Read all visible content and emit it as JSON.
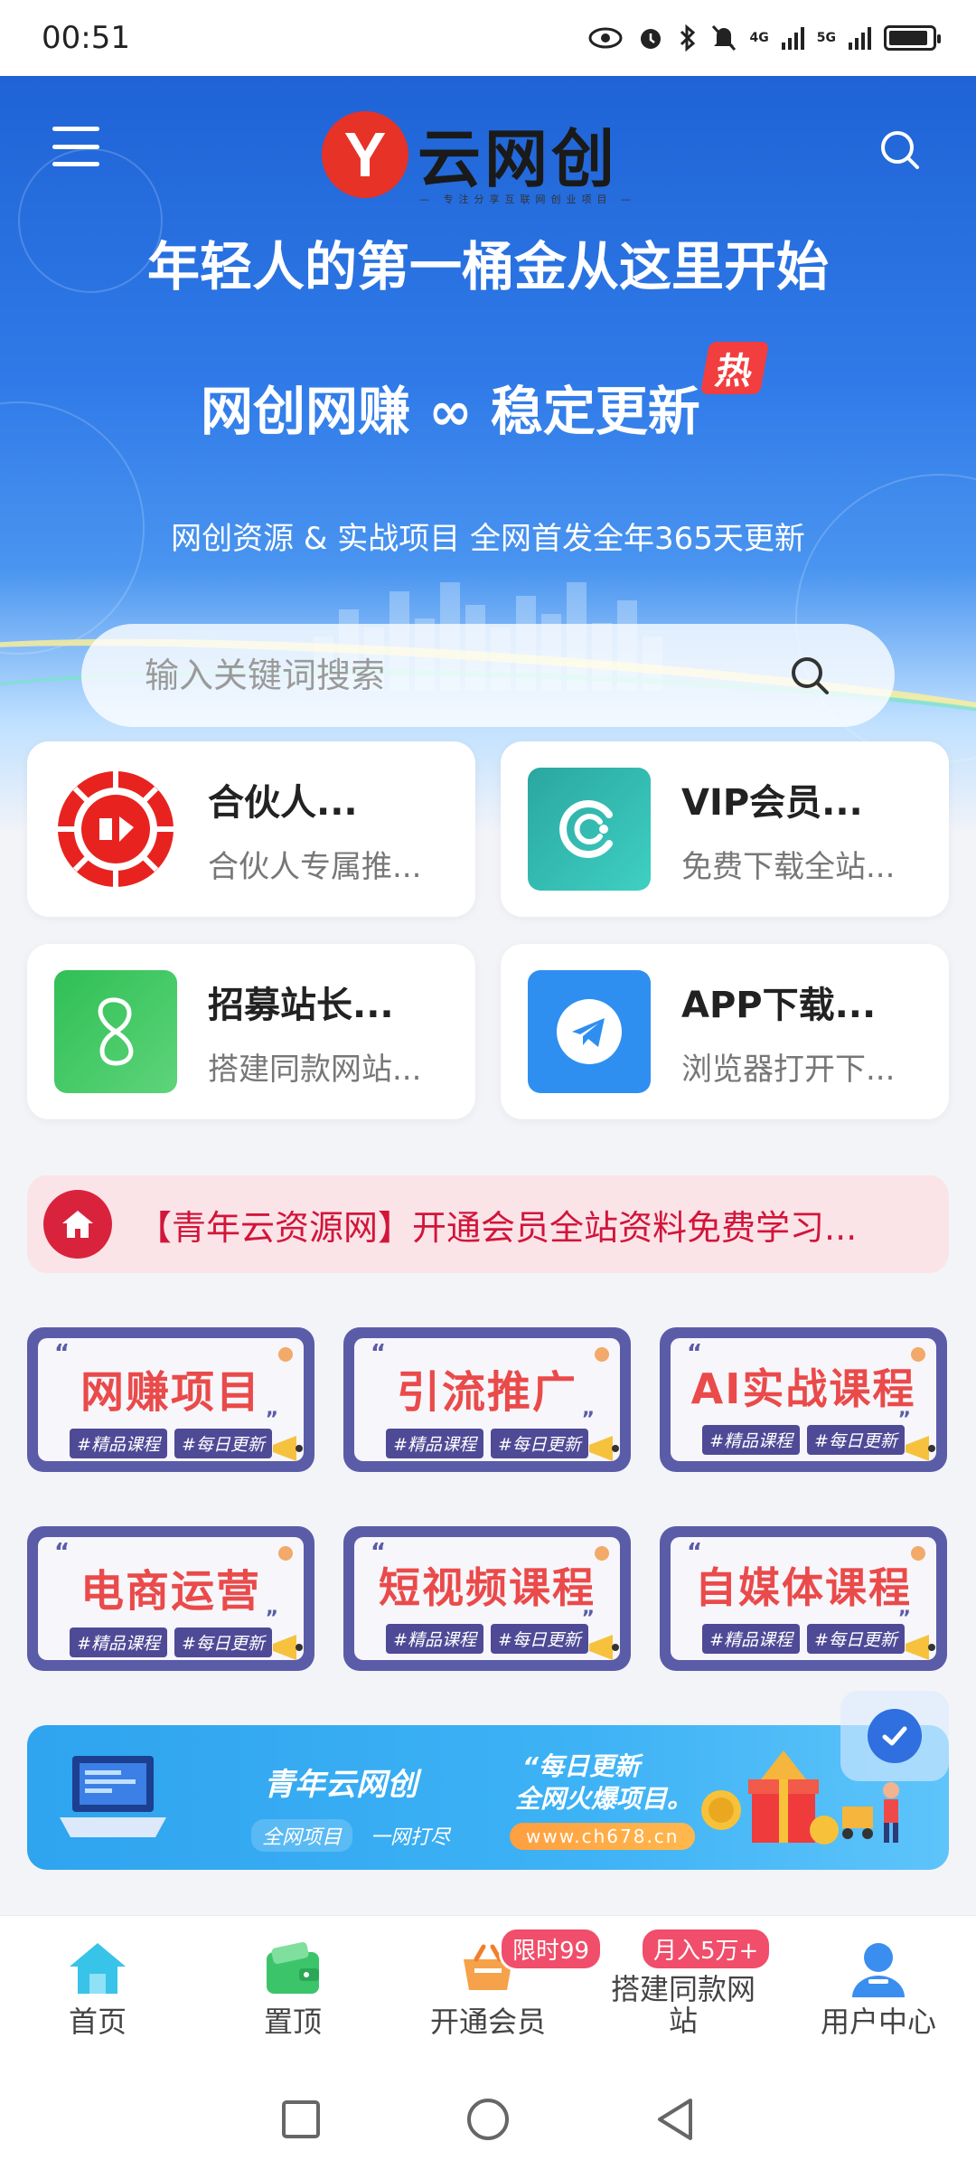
{
  "status_bar": {
    "time": "00:51",
    "network_1": "4G",
    "network_2": "5G",
    "icons": [
      "eye-icon",
      "alarm-icon",
      "bluetooth-icon",
      "mute-icon",
      "signal-icon",
      "signal-icon",
      "battery-icon"
    ]
  },
  "header": {
    "logo_letter": "Y",
    "logo_name": "云网创",
    "logo_tagline": "— 专注分享互联网创业项目 —"
  },
  "hero": {
    "headline_1": "年轻人的第一桶金从这里开始",
    "headline_2": "网创网赚 ∞ 稳定更新",
    "hot_badge": "热",
    "subtitle": "网创资源 & 实战项目 全网首发全年365天更新"
  },
  "search": {
    "placeholder": "输入关键词搜索"
  },
  "quick_cards": [
    {
      "title": "合伙人...",
      "desc": "合伙人专属推..."
    },
    {
      "title": "VIP会员...",
      "desc": "免费下载全站..."
    },
    {
      "title": "招募站长...",
      "desc": "搭建同款网站..."
    },
    {
      "title": "APP下载...",
      "desc": "浏览器打开下..."
    }
  ],
  "notice": {
    "text": "【青年云资源网】开通会员全站资料免费学习..."
  },
  "categories": {
    "tag_1": "#精品课程",
    "tag_2": "#每日更新",
    "items": [
      "网赚项目",
      "引流推广",
      "AI实战课程",
      "电商运营",
      "短视频课程",
      "自媒体课程"
    ]
  },
  "banner": {
    "title": "青年云网创",
    "sub_1": "全网项目",
    "sub_2": "一网打尽",
    "quote_1": "“每日更新",
    "quote_2": "全网火爆项目。",
    "url": "www.ch678.cn"
  },
  "bottom_nav": [
    {
      "label": "首页"
    },
    {
      "label": "置顶"
    },
    {
      "label": "开通会员",
      "badge": "限时99"
    },
    {
      "label": "搭建同款网站",
      "badge": "月入5万+"
    },
    {
      "label": "用户中心"
    }
  ],
  "colors": {
    "hero_blue": "#1f63d6",
    "accent_red": "#e73228",
    "notice_text": "#d2153a",
    "category_frame": "#5b5ca8",
    "badge_pink": "#f04e6b"
  }
}
